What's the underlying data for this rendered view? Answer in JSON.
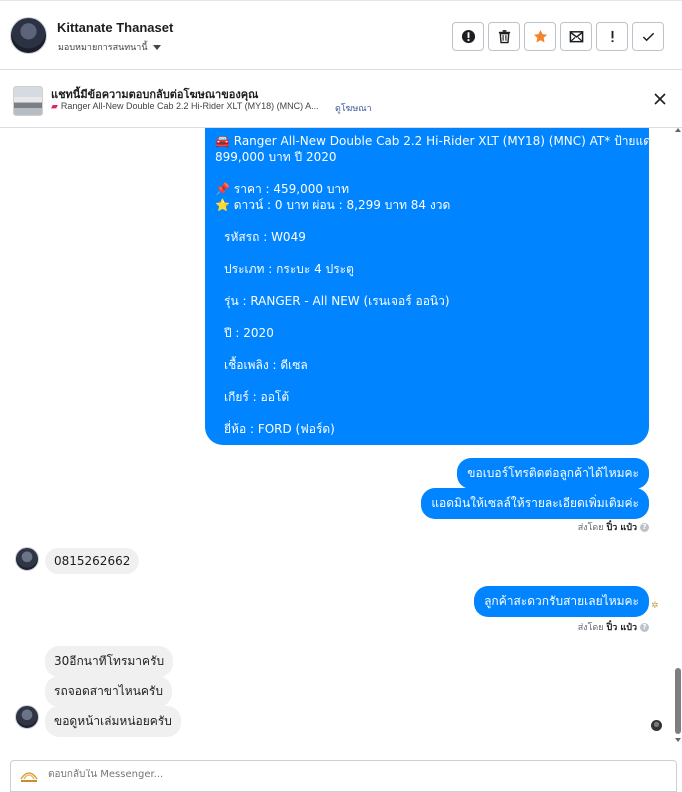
{
  "header": {
    "name": "Kittanate Thanaset",
    "subtitle": "มอบหมายการสนทนานี้",
    "actions": [
      {
        "icon": "alert-circle-icon",
        "name": "mark-spam-button"
      },
      {
        "icon": "trash-icon",
        "name": "delete-button"
      },
      {
        "icon": "star-icon",
        "name": "star-button"
      },
      {
        "icon": "mail-unread-icon",
        "name": "mark-unread-button"
      },
      {
        "icon": "exclamation-icon",
        "name": "follow-up-button"
      },
      {
        "icon": "check-icon",
        "name": "done-button"
      }
    ],
    "star_color": "#f5832a"
  },
  "ad_bar": {
    "title": "แชทนี้มีข้อความตอบกลับต่อโฆษณาของคุณ",
    "ad_text": "Ranger All-New Double Cab 2.2 Hi-Rider XLT (MY18) (MNC) A...",
    "view_ad": "ดูโฆษณา"
  },
  "main_bubble": {
    "lines": [
      "🚘 Ranger All-New Double Cab 2.2 Hi-Rider XLT (MY18) (MNC) AT* ป้ายแดง",
      "899,000 บาท ปี 2020",
      "",
      "📌 ราคา : 459,000 บาท",
      "⭐ ดาวน์ : 0 บาท ผ่อน : 8,299 บาท 84 งวด",
      "",
      "รหัสรถ : W049",
      "",
      "ประเภท : กระบะ 4 ประตู",
      "",
      "รุ่น : RANGER - All NEW (เรนเจอร์ ออนิว)",
      "",
      "ปี : 2020",
      "",
      "เชื้อเพลิง : ดีเซล",
      "",
      "เกียร์ : ออโต้",
      "",
      "ยี่ห้อ : FORD (ฟอร์ด)"
    ]
  },
  "messages": {
    "out1": "ขอเบอร์โทรติดต่อลูกค้าได้ไหมคะ",
    "out2": "แอดมินให้เซลล์ให้รายละเอียดเพิ่มเติมค่ะ",
    "sent_by_label": "ส่งโดย",
    "sent_by_name": "ปิ๋ว แป๋ว",
    "in1": "0815262662",
    "out3": "ลูกค้าสะดวกรับสายเลยไหมคะ",
    "in2": "30อีกนาทีโทรมาครับ",
    "in3": "รถจอดสาขาไหนครับ",
    "in4": "ขอดูหน้าเล่มหน่อยครับ"
  },
  "composer": {
    "placeholder": "ตอบกลับใน Messenger..."
  },
  "colors": {
    "outgoing_bubble": "#0084ff",
    "incoming_bubble": "#f1f0f0"
  }
}
